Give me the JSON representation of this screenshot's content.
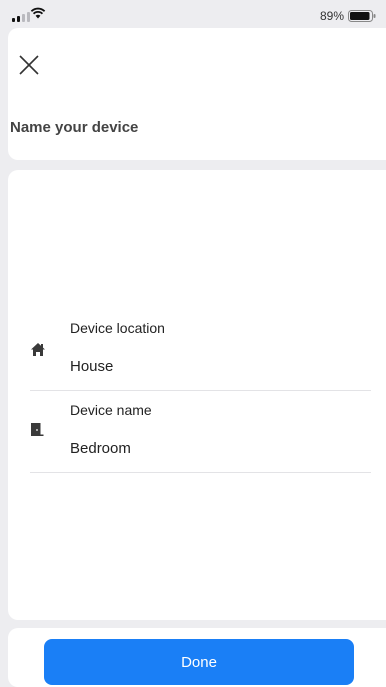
{
  "status_bar": {
    "battery_percent": "89%",
    "signal_icon": "cellular-signal-icon",
    "wifi_icon": "wifi-icon",
    "battery_icon": "battery-icon"
  },
  "header": {
    "close_icon": "close-icon",
    "title": "Name your device"
  },
  "fields": [
    {
      "icon": "house-icon",
      "label": "Device location",
      "value": "House"
    },
    {
      "icon": "door-icon",
      "label": "Device name",
      "value": "Bedroom"
    }
  ],
  "footer": {
    "done_label": "Done"
  },
  "colors": {
    "accent": "#1a7ff6",
    "background": "#ededf0",
    "card": "#ffffff"
  }
}
